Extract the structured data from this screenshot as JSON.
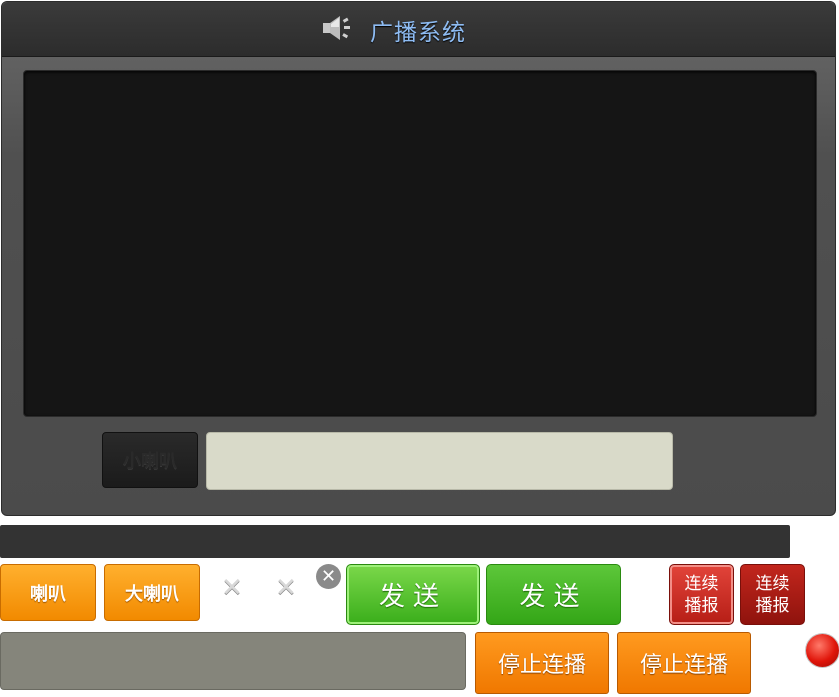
{
  "window": {
    "title": "广播系统",
    "title_icon": "speaker-icon"
  },
  "input": {
    "mode_label": "小喇叭",
    "message_value": ""
  },
  "controls": {
    "horn_label": "喇叭",
    "big_horn_label": "大喇叭",
    "send_label": "发送",
    "send_hover_label": "发送",
    "loop_label": "连续\n播报",
    "loop_hover_label": "连续\n播报",
    "stop_loop_label": "停止连播",
    "stop_loop_hover_label": "停止连播",
    "close_icon": "close-icon",
    "record_icon": "record-dot-icon"
  },
  "colors": {
    "title_text": "#8ebcf3",
    "orange": "#f28a00",
    "green": "#3aae1b",
    "red": "#b61e16",
    "panel_dark": "#151515"
  }
}
